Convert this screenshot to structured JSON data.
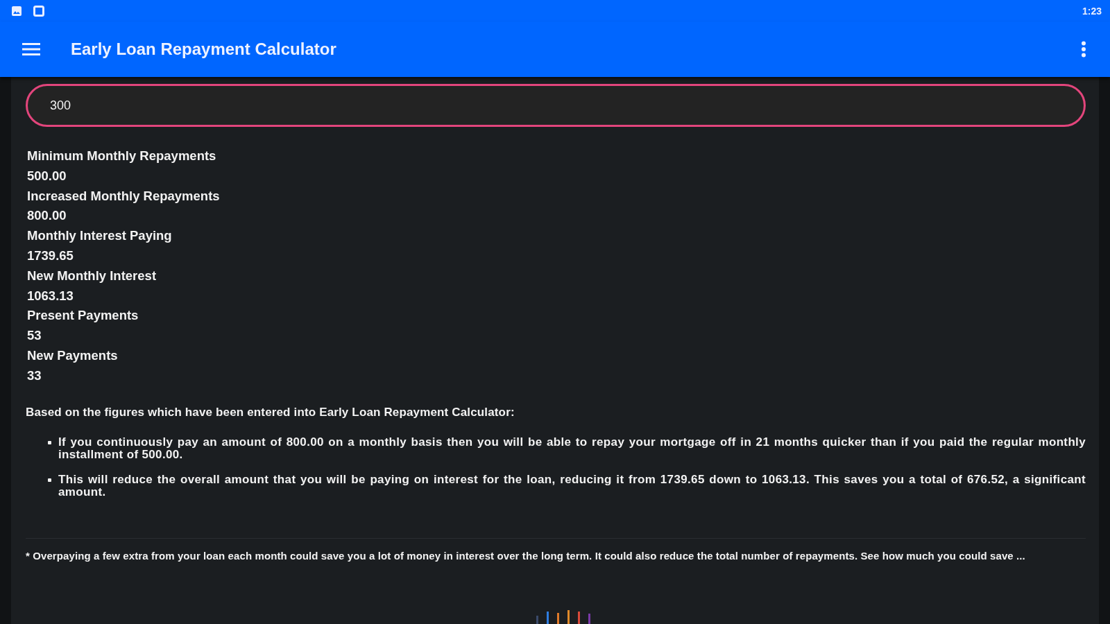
{
  "status_bar": {
    "time": "1:23"
  },
  "app_bar": {
    "title": "Early Loan Repayment Calculator"
  },
  "amount_field": {
    "value": "300",
    "focused": true
  },
  "results": [
    {
      "label": "Minimum Monthly Repayments",
      "value": "500.00"
    },
    {
      "label": "Increased Monthly Repayments",
      "value": "800.00"
    },
    {
      "label": "Monthly Interest Paying",
      "value": "1739.65"
    },
    {
      "label": "New Monthly Interest",
      "value": "1063.13"
    },
    {
      "label": "Present Payments",
      "value": "53"
    },
    {
      "label": "New Payments",
      "value": "33"
    }
  ],
  "summary": {
    "intro": "Based on the figures which have been entered into Early Loan Repayment Calculator:",
    "points": [
      "If you continuously pay an amount of 800.00 on a monthly basis then you will be able to repay your mortgage off in 21 months quicker than if you paid the regular monthly installment of 500.00.",
      "This will reduce the overall amount that you will be paying on interest for the loan, reducing it from 1739.65 down to 1063.13. This saves you a total of 676.52, a significant amount."
    ]
  },
  "footnote": "* Overpaying a few extra from your loan each month could save you a lot of money in interest over the long term. It could also reduce the total number of repayments. See how much you could save ..."
}
